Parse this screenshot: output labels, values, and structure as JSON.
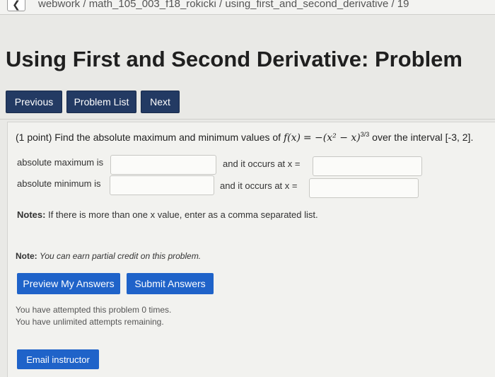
{
  "breadcrumb": {
    "back_icon": "chevron-left-icon",
    "path": "webwork / math_105_003_f18_rokicki / using_first_and_second_derivative / 19"
  },
  "page": {
    "title": "Using First and Second Derivative: Problem"
  },
  "nav": {
    "previous": "Previous",
    "problem_list": "Problem List",
    "next": "Next"
  },
  "problem": {
    "intro": "(1 point) Find the absolute maximum and minimum values of",
    "function_lhs": "f(x)",
    "function_rhs": "−(x² − x)",
    "exponent": "3/3",
    "interval_text": "over the interval [-3, 2]."
  },
  "answers": {
    "max_label": "absolute maximum is",
    "max_occurs_label": "and it occurs at x =",
    "min_label": "absolute minimum is",
    "min_occurs_label": "and it occurs at x =",
    "max_value": "",
    "max_x": "",
    "min_value": "",
    "min_x": ""
  },
  "notes": {
    "prefix": "Notes:",
    "text": "If there is more than one x value, enter as a comma separated list."
  },
  "credit": {
    "prefix": "Note:",
    "text": "You can earn partial credit on this problem."
  },
  "actions": {
    "preview": "Preview My Answers",
    "submit": "Submit Answers",
    "email": "Email instructor"
  },
  "attempts": {
    "line1": "You have attempted this problem 0 times.",
    "line2": "You have unlimited attempts remaining."
  },
  "colors": {
    "nav_button": "#233a63",
    "action_button": "#1f63c9"
  }
}
